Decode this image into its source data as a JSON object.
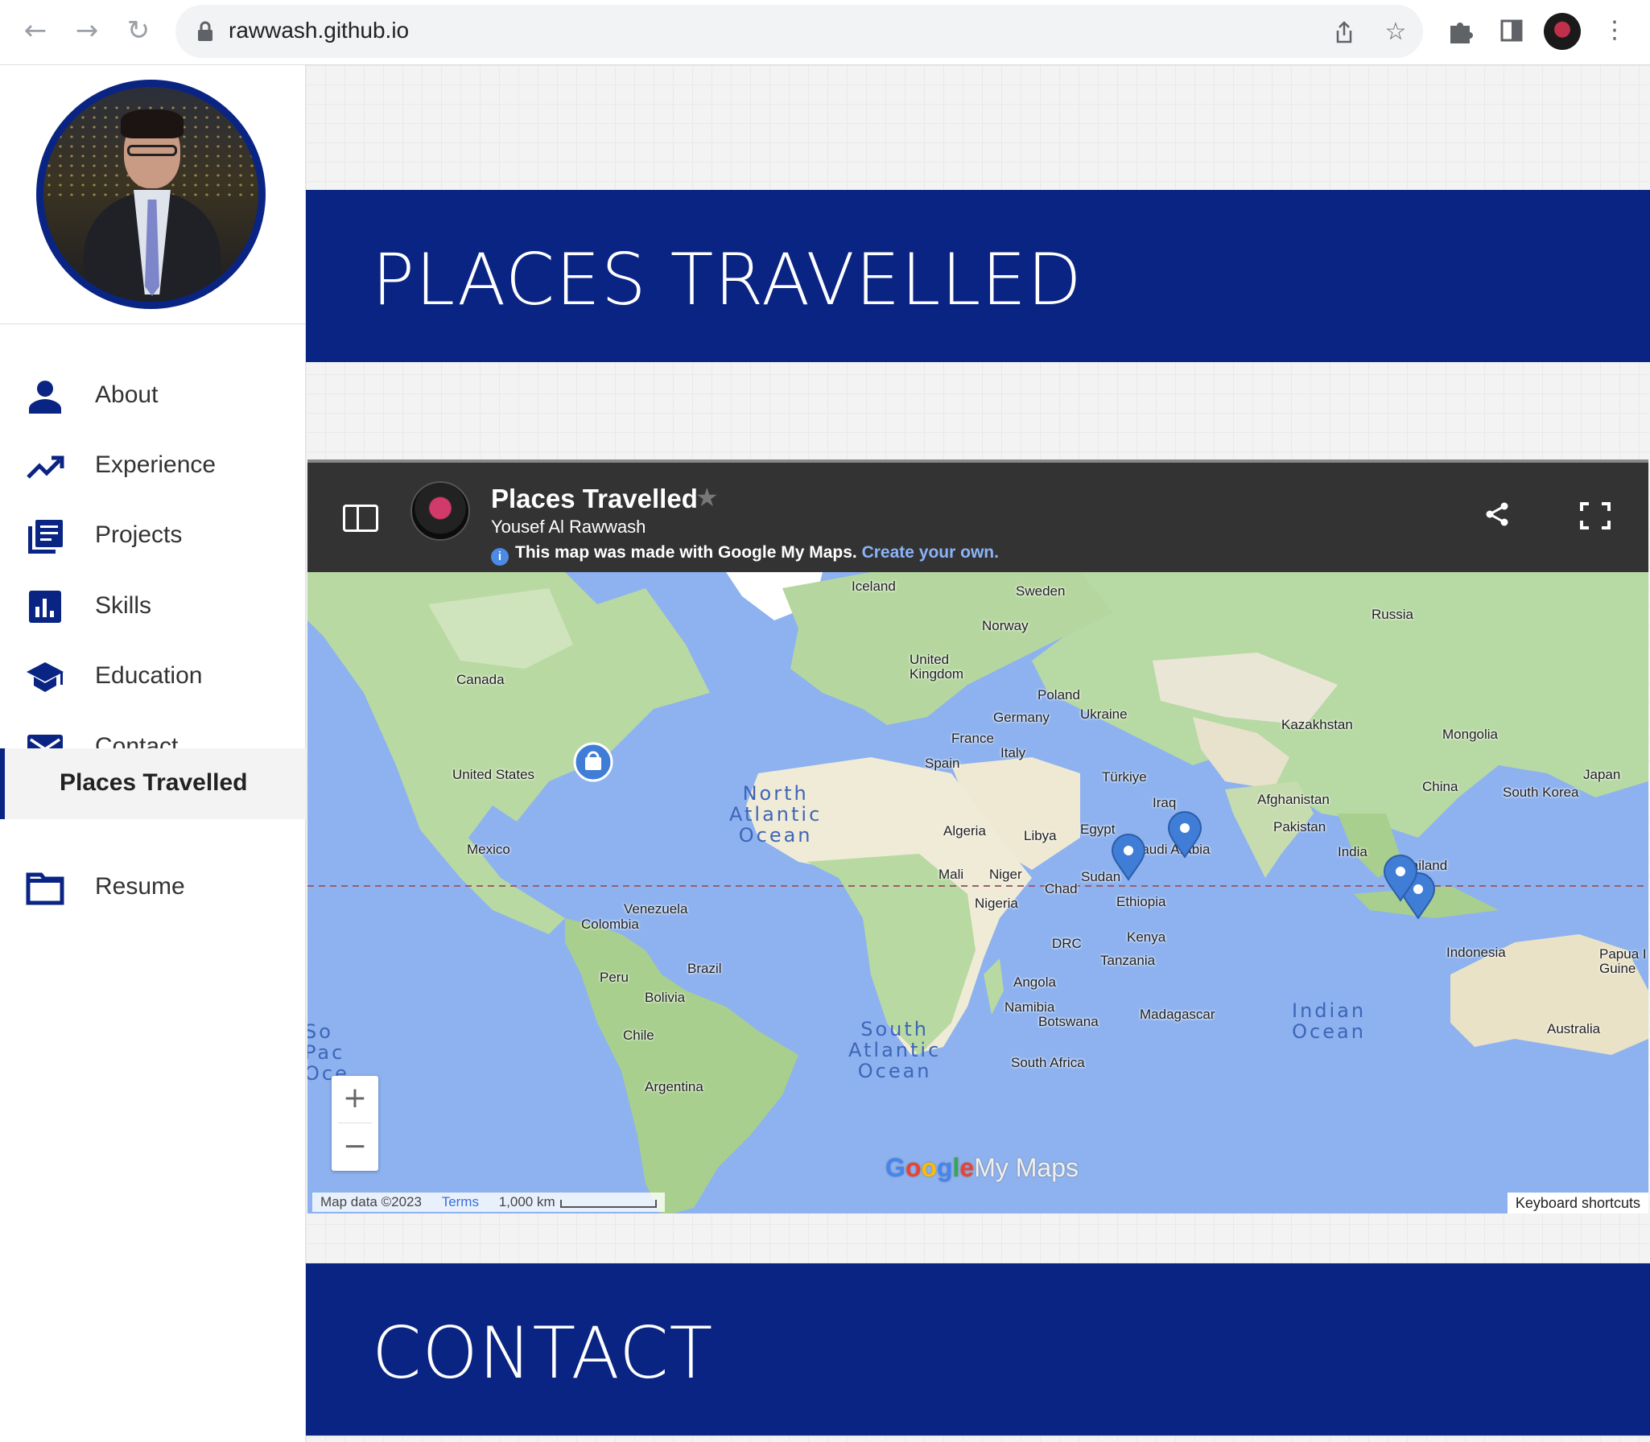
{
  "browser": {
    "url": "rawwash.github.io",
    "icons": [
      "back-icon",
      "forward-icon",
      "reload-icon",
      "lock-icon",
      "share-icon",
      "bookmark-star-icon",
      "extensions-icon",
      "sidepanel-icon",
      "profile-avatar",
      "more-icon"
    ]
  },
  "sidebar": {
    "items": [
      {
        "label": "About",
        "icon": "person-icon"
      },
      {
        "label": "Experience",
        "icon": "trending-up-icon"
      },
      {
        "label": "Projects",
        "icon": "library-books-icon"
      },
      {
        "label": "Skills",
        "icon": "bar-chart-icon"
      },
      {
        "label": "Education",
        "icon": "graduation-cap-icon"
      },
      {
        "label": "Contact",
        "icon": "mail-icon"
      },
      {
        "label": "Places Travelled",
        "icon": "",
        "active": true
      },
      {
        "label": "Resume",
        "icon": "folder-icon"
      }
    ]
  },
  "sections": {
    "places_title": "PLACES TRAVELLED",
    "contact_title": "CONTACT"
  },
  "map": {
    "title": "Places Travelled",
    "author": "Yousef Al Rawwash",
    "note": "This map made with Google My Maps.",
    "note_full": "This map was made with Google My Maps.",
    "note_link": "Create your own.",
    "logo_google": [
      "G",
      "o",
      "o",
      "g",
      "l",
      "e"
    ],
    "logo_mymaps": "My Maps",
    "attribution": "Map data ©2023",
    "terms": "Terms",
    "scale": "1,000 km",
    "keyboard_shortcuts": "Keyboard shortcuts",
    "zoom_in": "+",
    "zoom_out": "−",
    "places": [
      "Iceland",
      "Sweden",
      "Russia",
      "Norway",
      "United\nKingdom",
      "Poland",
      "Canada",
      "Germany",
      "Ukraine",
      "Kazakhstan",
      "France",
      "Mongolia",
      "Italy",
      "Spain",
      "United States",
      "Türkiye",
      "Japan",
      "China",
      "South Korea",
      "Iraq",
      "Afghanistan",
      "Pakistan",
      "Algeria",
      "Libya",
      "Egypt",
      "Saudi Arabia",
      "Mexico",
      "India",
      "Thailand",
      "Mali",
      "Niger",
      "Sudan",
      "Chad",
      "Nigeria",
      "Ethiopia",
      "Venezuela",
      "Colombia",
      "Kenya",
      "DRC",
      "Indonesia",
      "Papua I\nGuine",
      "Tanzania",
      "Brazil",
      "Peru",
      "Angola",
      "Bolivia",
      "Namibia",
      "Madagascar",
      "Botswana",
      "Chile",
      "South Africa",
      "Australia",
      "Argentina"
    ],
    "oceans": [
      "North\nAtlantic\nOcean",
      "South\nAtlantic\nOcean",
      "Indian\nOcean",
      "So\nPac\nOce"
    ],
    "markers": [
      "home-pin-icon",
      "map-pin-icon",
      "map-pin-icon",
      "map-pin-icon",
      "map-pin-icon"
    ]
  },
  "colors": {
    "accent": "#0a2483",
    "map_header": "#333333",
    "ocean": "#8db2ef",
    "land": "#b7d9a4",
    "marker": "#3f7dd6"
  }
}
